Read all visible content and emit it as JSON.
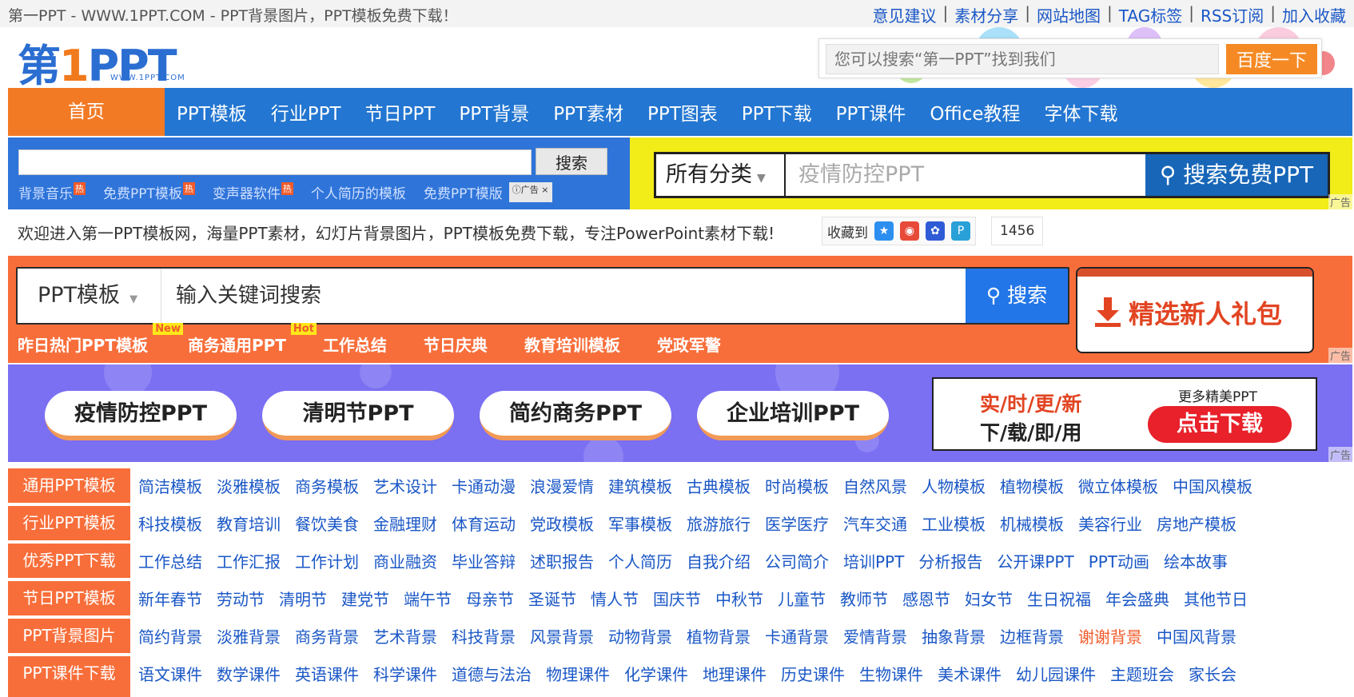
{
  "topbar": {
    "title": "第一PPT - WWW.1PPT.COM - PPT背景图片，PPT模板免费下载！",
    "links": [
      "意见建议",
      "素材分享",
      "网站地图",
      "TAG标签",
      "RSS订阅",
      "加入收藏"
    ]
  },
  "logo": {
    "text_main": "第",
    "text_one": "1",
    "text_ppt": "PPT",
    "sub": "WWW.1PPT.COM"
  },
  "header_search": {
    "placeholder": "您可以搜索“第一PPT”找到我们",
    "button": "百度一下"
  },
  "nav": {
    "home": "首页",
    "items": [
      "PPT模板",
      "行业PPT",
      "节日PPT",
      "PPT背景",
      "PPT素材",
      "PPT图表",
      "PPT下载",
      "PPT课件",
      "Office教程",
      "字体下载"
    ]
  },
  "ad_search_left": {
    "button": "搜索",
    "links": [
      "背景音乐",
      "免费PPT模板",
      "变声器软件",
      "个人简历的模板",
      "免费PPT模版"
    ],
    "hot": "热",
    "ad_label": "广告",
    "close": "×"
  },
  "ad_search_right": {
    "category": "所有分类",
    "placeholder": "疫情防控PPT",
    "button": "搜索免费PPT",
    "ad_label": "广告"
  },
  "welcome": {
    "text": "欢迎进入第一PPT模板网，海量PPT素材，幻灯片背景图片，PPT模板免费下载，专注PowerPoint素材下载!",
    "collect_label": "收藏到",
    "count": "1456"
  },
  "main_search": {
    "category": "PPT模板",
    "placeholder": "输入关键词搜索",
    "button": "搜索",
    "tags": [
      "昨日热门PPT模板",
      "商务通用PPT",
      "工作总结",
      "节日庆典",
      "教育培训模板",
      "党政军警"
    ],
    "badge_new": "New",
    "badge_hot": "Hot",
    "gift": "精选新人礼包",
    "ad_label": "广告"
  },
  "banner": {
    "pills": [
      "疫情防控PPT",
      "清明节PPT",
      "简约商务PPT",
      "企业培训PPT"
    ],
    "line1": "实/时/更/新",
    "line2": "下/载/即/用",
    "more": "更多精美PPT",
    "button": "点击下载",
    "ad_label": "广告"
  },
  "categories": [
    {
      "label": "通用PPT模板",
      "links": [
        "简洁模板",
        "淡雅模板",
        "商务模板",
        "艺术设计",
        "卡通动漫",
        "浪漫爱情",
        "建筑模板",
        "古典模板",
        "时尚模板",
        "自然风景",
        "人物模板",
        "植物模板",
        "微立体模板",
        "中国风模板"
      ]
    },
    {
      "label": "行业PPT模板",
      "links": [
        "科技模板",
        "教育培训",
        "餐饮美食",
        "金融理财",
        "体育运动",
        "党政模板",
        "军事模板",
        "旅游旅行",
        "医学医疗",
        "汽车交通",
        "工业模板",
        "机械模板",
        "美容行业",
        "房地产模板"
      ]
    },
    {
      "label": "优秀PPT下载",
      "links": [
        "工作总结",
        "工作汇报",
        "工作计划",
        "商业融资",
        "毕业答辩",
        "述职报告",
        "个人简历",
        "自我介绍",
        "公司简介",
        "培训PPT",
        "分析报告",
        "公开课PPT",
        "PPT动画",
        "绘本故事"
      ]
    },
    {
      "label": "节日PPT模板",
      "links": [
        "新年春节",
        "劳动节",
        "清明节",
        "建党节",
        "端午节",
        "母亲节",
        "圣诞节",
        "情人节",
        "国庆节",
        "中秋节",
        "儿童节",
        "教师节",
        "感恩节",
        "妇女节",
        "生日祝福",
        "年会盛典",
        "其他节日"
      ]
    },
    {
      "label": "PPT背景图片",
      "links": [
        "简约背景",
        "淡雅背景",
        "商务背景",
        "艺术背景",
        "科技背景",
        "风景背景",
        "动物背景",
        "植物背景",
        "卡通背景",
        "爱情背景",
        "抽象背景",
        "边框背景",
        "谢谢背景",
        "中国风背景"
      ]
    },
    {
      "label": "PPT课件下载",
      "links": [
        "语文课件",
        "数学课件",
        "英语课件",
        "科学课件",
        "道德与法治",
        "物理课件",
        "化学课件",
        "地理课件",
        "历史课件",
        "生物课件",
        "美术课件",
        "幼儿园课件",
        "主题班会",
        "家长会"
      ]
    }
  ],
  "colors": {
    "nav_blue": "#2376d1",
    "accent_orange": "#f86e3a",
    "link_blue": "#1a57c6",
    "banner_purple": "#7b6ff2",
    "ad_yellow": "#f2ec19"
  }
}
